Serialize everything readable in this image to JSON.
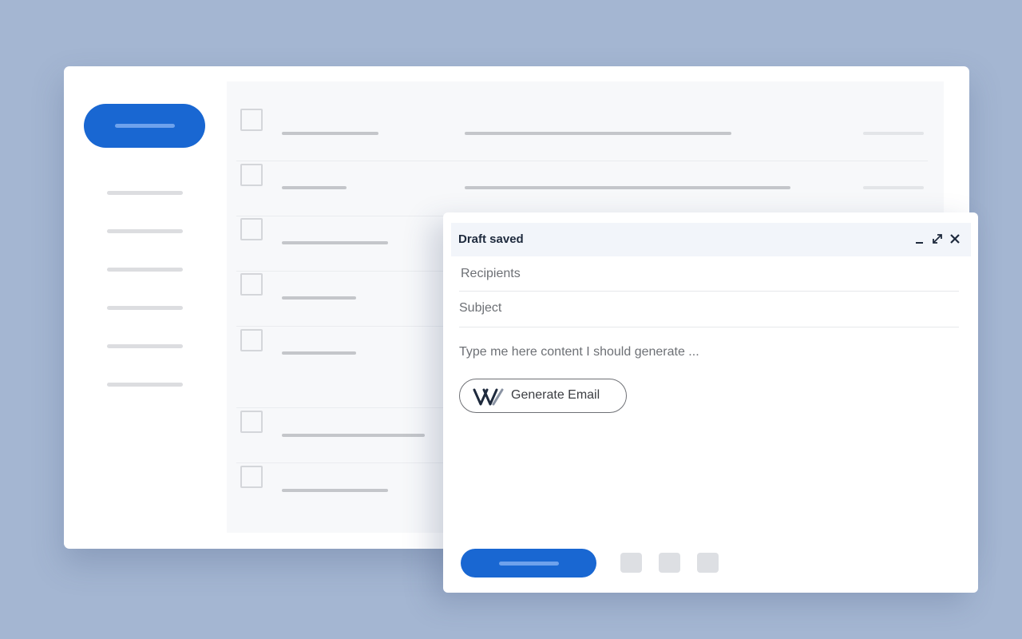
{
  "compose": {
    "title": "Draft saved",
    "recipients_placeholder": "Recipients",
    "subject_placeholder": "Subject",
    "body_placeholder": "Type me here content I should generate ...",
    "generate_button_label": "Generate Email",
    "header_icons": [
      "minimize-icon",
      "expand-icon",
      "close-icon"
    ],
    "toolbar_icons": [
      "format-icon",
      "attach-icon",
      "more-icon"
    ]
  },
  "colors": {
    "background": "#a4b6d2",
    "accent": "#1967d2",
    "compose_header": "#f2f5fa"
  }
}
